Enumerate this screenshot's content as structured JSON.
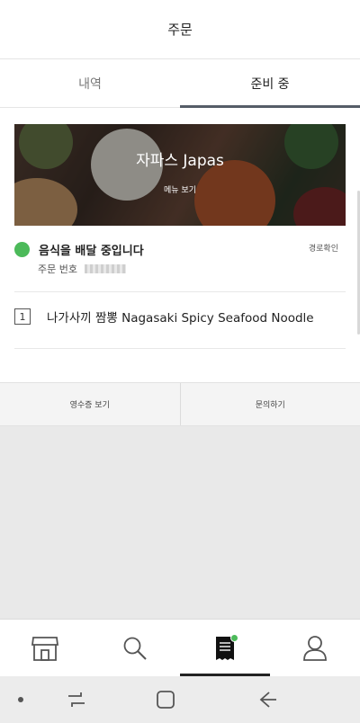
{
  "header": {
    "title": "주문"
  },
  "tabs": [
    {
      "label": "내역",
      "active": false
    },
    {
      "label": "준비 중",
      "active": true
    }
  ],
  "restaurant": {
    "name": "자파스 Japas",
    "menu_link": "메뉴 보기"
  },
  "order": {
    "status": "음식을 배달 중입니다",
    "status_color": "#4cba5a",
    "route_link": "경로확인",
    "number_label": "주문 번호"
  },
  "items": [
    {
      "qty": "1",
      "name": "나가사끼 짬뽕 Nagasaki Spicy Seafood Noodle"
    }
  ],
  "actions": {
    "receipt": "영수증 보기",
    "inquiry": "문의하기"
  },
  "bottom_nav": [
    {
      "icon": "store-icon",
      "active": false
    },
    {
      "icon": "search-icon",
      "active": false
    },
    {
      "icon": "receipt-icon",
      "active": true,
      "badge": true
    },
    {
      "icon": "profile-icon",
      "active": false
    }
  ],
  "system_nav": [
    "dot-icon",
    "recent-apps-icon",
    "home-icon",
    "back-icon"
  ]
}
